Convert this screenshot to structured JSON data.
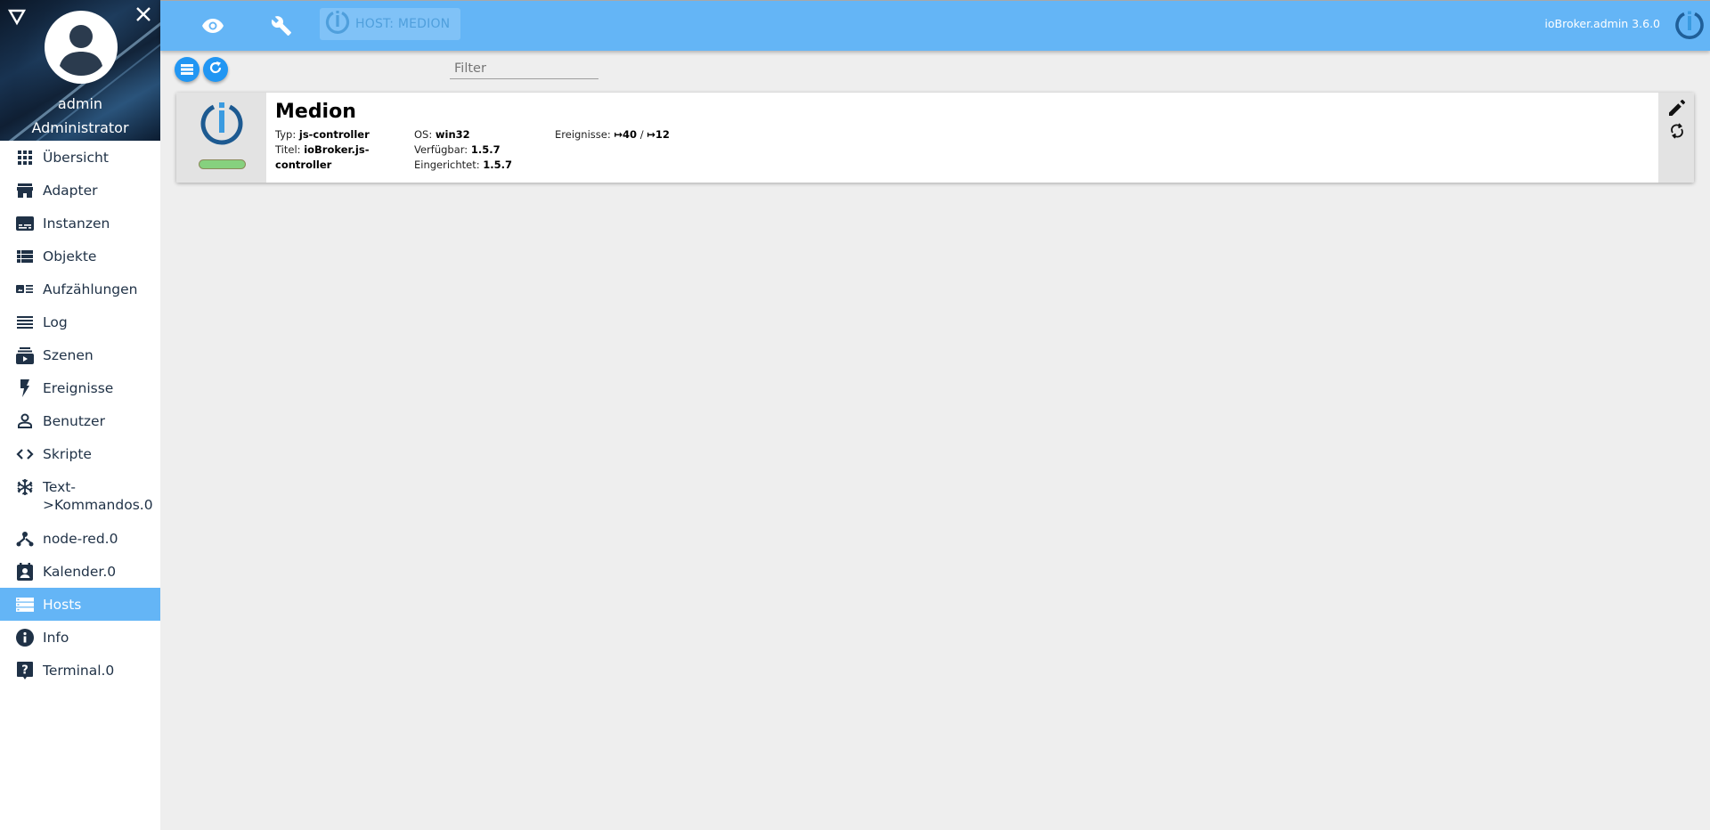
{
  "sidebar": {
    "user": {
      "name": "admin",
      "role": "Administrator"
    },
    "items": [
      {
        "label": "Übersicht",
        "icon": "apps-grid-icon",
        "active": false
      },
      {
        "label": "Adapter",
        "icon": "store-icon",
        "active": false
      },
      {
        "label": "Instanzen",
        "icon": "subtitles-icon",
        "active": false
      },
      {
        "label": "Objekte",
        "icon": "view-list-icon",
        "active": false
      },
      {
        "label": "Aufzählungen",
        "icon": "featured-list-icon",
        "active": false
      },
      {
        "label": "Log",
        "icon": "lines-icon",
        "active": false
      },
      {
        "label": "Szenen",
        "icon": "subscriptions-icon",
        "active": false
      },
      {
        "label": "Ereignisse",
        "icon": "flash-icon",
        "active": false
      },
      {
        "label": "Benutzer",
        "icon": "person-outline-icon",
        "active": false
      },
      {
        "label": "Skripte",
        "icon": "code-icon",
        "active": false
      },
      {
        "label": "Text->Kommandos.0",
        "icon": "snowflake-icon",
        "active": false
      },
      {
        "label": "node-red.0",
        "icon": "node-tree-icon",
        "active": false
      },
      {
        "label": "Kalender.0",
        "icon": "contact-calendar-icon",
        "active": false
      },
      {
        "label": "Hosts",
        "icon": "storage-icon",
        "active": true
      },
      {
        "label": "Info",
        "icon": "info-icon",
        "active": false
      },
      {
        "label": "Terminal.0",
        "icon": "help-bubble-icon",
        "active": false
      }
    ]
  },
  "header": {
    "host_label": "HOST: MEDION",
    "version": "ioBroker.admin 3.6.0",
    "icons": [
      "eye-icon",
      "wrench-icon",
      "iobroker-logo-icon"
    ]
  },
  "toolbar": {
    "filter_placeholder": "Filter",
    "filter_value": ""
  },
  "hosts": [
    {
      "name": "Medion",
      "type_label": "Typ:",
      "type": "js-controller",
      "title_label": "Titel:",
      "title": "ioBroker.js-controller",
      "os_label": "OS:",
      "os": "win32",
      "available_label": "Verfügbar:",
      "available": "1.5.7",
      "installed_label": "Eingerichtet:",
      "installed": "1.5.7",
      "events_label": "Ereignisse:",
      "events_in": "↦40",
      "events_sep": "/",
      "events_out": "↦12",
      "status_color": "#86d17e"
    }
  ],
  "colors": {
    "accent": "#64b5f6",
    "button": "#2196f3",
    "sidebar_text": "#1f3146",
    "background": "#eeeeee"
  }
}
